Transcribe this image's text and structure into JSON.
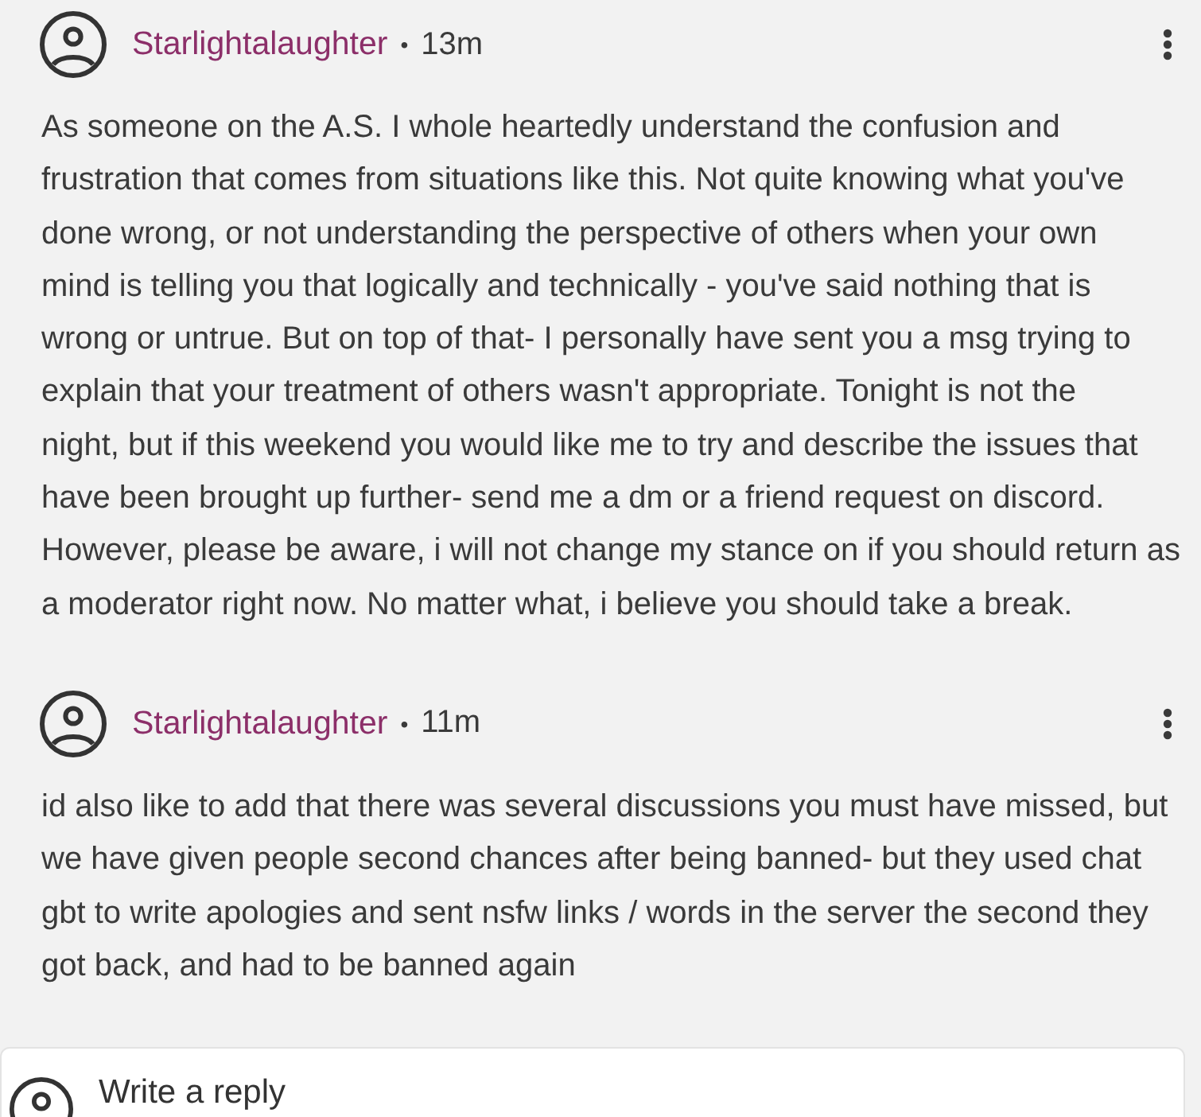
{
  "comments": [
    {
      "author": "Starlightalaughter",
      "separator": "•",
      "time": "13m",
      "lines": [
        "As someone on the A.S. I whole heartedly understand the confusion and",
        "frustration that comes from situations like this. Not quite knowing what you've",
        "done wrong, or not understanding the perspective of others when your own",
        "mind is telling you that logically and technically - you've said nothing that is",
        "wrong or untrue. But on top of that- I personally have sent you a msg trying to",
        "explain that your treatment of others wasn't appropriate. Tonight is not the",
        "night, but if this weekend you would like me to try and describe the issues that",
        "have been brought up further- send me a dm or a friend request on discord.",
        "However, please be aware, i will not change my stance on if you should return as",
        "a moderator right now. No matter what, i believe you should take a break."
      ]
    },
    {
      "author": "Starlightalaughter",
      "separator": "•",
      "time": "11m",
      "lines": [
        "id also like to add that there was several discussions you must have missed, but",
        "we have given people second chances after being banned- but they used chat",
        "gbt to write apologies and sent nsfw links / words in the server the second they",
        "got back, and had to be banned again"
      ]
    }
  ],
  "reply_box": {
    "placeholder": "Write a reply"
  }
}
